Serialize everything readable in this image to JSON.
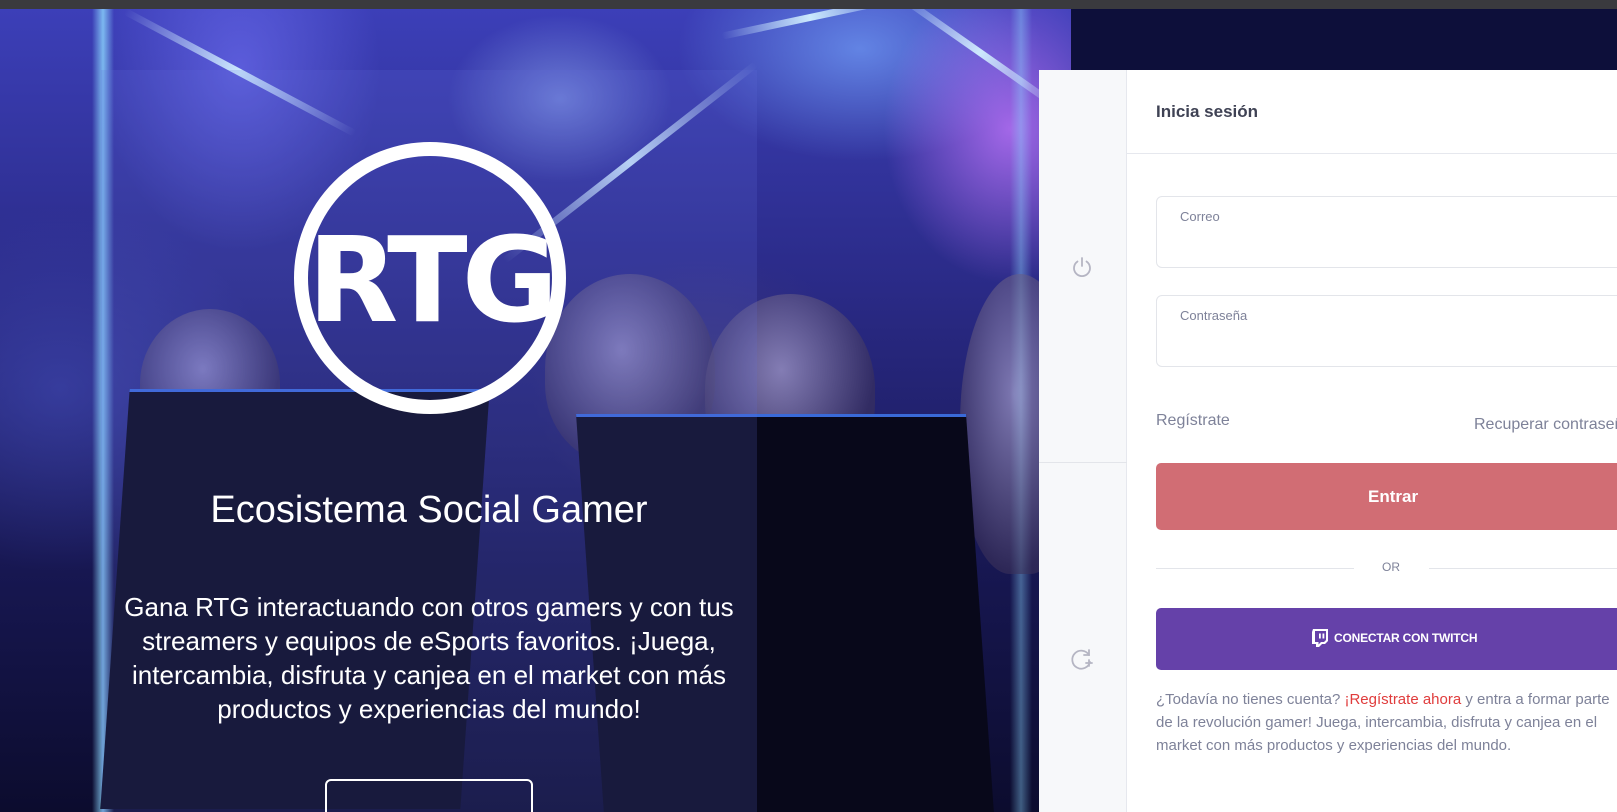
{
  "hero": {
    "logo_text": "RTG",
    "title": "Ecosistema Social Gamer",
    "description": "Gana RTG interactuando con otros gamers y con tus streamers y equipos de eSports favoritos. ¡Juega, intercambia, disfruta y canjea en el market con más productos y experiencias del mundo!"
  },
  "sidebar": {
    "icons": [
      "power-icon",
      "refresh-icon"
    ]
  },
  "login": {
    "title": "Inicia sesión",
    "email_label": "Correo",
    "email_value": "",
    "password_label": "Contraseña",
    "password_value": "",
    "register_link": "Regístrate",
    "recover_link": "Recuperar contraseña",
    "submit_label": "Entrar",
    "or_text": "OR",
    "twitch_label": "CONECTAR CON TWITCH",
    "signup_prefix": "¿Todavía no tienes cuenta? ",
    "signup_link": "¡Regístrate ahora",
    "signup_suffix": " y entra a formar parte de la revolución gamer! Juega, intercambia, disfruta y canjea en el market con más productos y experiencias del mundo."
  },
  "colors": {
    "submit_button": "#d16d74",
    "twitch_button": "#6541a9",
    "signup_link": "#e03c3c",
    "muted_text": "#7e8299"
  }
}
